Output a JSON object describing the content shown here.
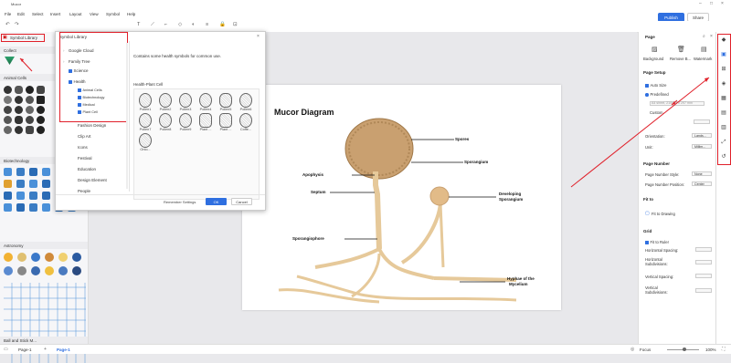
{
  "app": {
    "title": "Mucor"
  },
  "menu": [
    "File",
    "Edit",
    "Select",
    "Insert",
    "Layout",
    "View",
    "Symbol",
    "Help"
  ],
  "header": {
    "publish": "Publish",
    "share": "Share"
  },
  "left_panel": {
    "library_title": "Symbol Library",
    "sections": [
      "Collect",
      "Animal Cells",
      "Biotechnology",
      "Astronomy",
      "Ball and Stick M..."
    ]
  },
  "dialog": {
    "title": "Symbol Library",
    "description": "Contains some health symbols for common use.",
    "category_title": "Health-Plant Cell",
    "list_top": [
      "Google Cloud",
      "Family Tree"
    ],
    "science": "Science",
    "health": "Health",
    "health_sub": [
      "Animal Cells",
      "Biotechnology",
      "Medical",
      "Plant Cell"
    ],
    "list_bottom": [
      "Fashion Design",
      "Clip Art",
      "Icons",
      "Festival",
      "Education",
      "Design Element",
      "People"
    ],
    "symbols": [
      "Pollen1",
      "Pollen2",
      "Pollen3",
      "Pollen4",
      "Pollen5",
      "Pollen6",
      "Pollen7",
      "Pollen8",
      "Pollen9",
      "Plant ...",
      "Plant ...",
      "Coffe...",
      "Onio..."
    ],
    "remember": "Remember Settings",
    "ok": "OK",
    "cancel": "Cancel"
  },
  "diagram": {
    "title": "Mucor Diagram",
    "labels": {
      "spores": "Spores",
      "sporangium": "Sporangium",
      "apophysis": "Apophysis",
      "septum": "Septum",
      "developing1": "Developing",
      "developing2": "Sporangium",
      "sporangiophore": "Sporangiophore",
      "hyphae1": "Hyphae of the",
      "hyphae2": "Mycelium"
    }
  },
  "right_panel": {
    "page": "Page",
    "background": "Background",
    "remove_bg": "Remove B...",
    "watermark": "Watermark",
    "page_setup": "Page Setup",
    "auto_size": "Auto Size",
    "predefined": "Predefined",
    "paper": "A4 sheet, 210mm x 297 mm",
    "custom": "Custom",
    "orientation": "Orientation:",
    "orientation_val": "Lands...",
    "unit": "Unit:",
    "unit_val": "Millim...",
    "page_number": "Page Number",
    "pn_style": "Page Number Style:",
    "pn_style_val": "None",
    "pn_position": "Page Number Position:",
    "pn_position_val": "Center",
    "fit_to": "Fit to",
    "fit_drawing": "Fit to Drawing",
    "grid": "Grid",
    "fit_ruler": "Fit to Ruler",
    "h_spacing": "Horizontal Spacing:",
    "h_sub1": "Horizontal",
    "h_sub2": "Subdivisions:",
    "v_spacing": "Vertical Spacing:",
    "v_sub1": "Vertical",
    "v_sub2": "Subdivisions:"
  },
  "status": {
    "page_select": "Page-1",
    "page_tab": "Page-1",
    "focus": "Focus",
    "zoom": "100%"
  },
  "colors": {
    "accent": "#2f6fe0",
    "highlight": "#e0202a",
    "fungus": "#e6c99a"
  }
}
